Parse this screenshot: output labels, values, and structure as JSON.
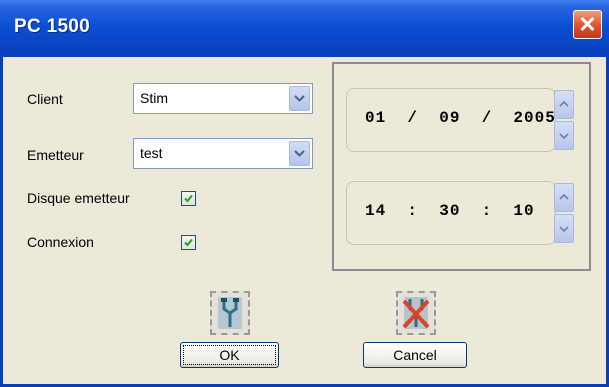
{
  "window": {
    "title": "PC 1500",
    "close_glyph": "✕"
  },
  "form": {
    "client_label": "Client",
    "client_value": "Stim",
    "emetteur_label": "Emetteur",
    "emetteur_value": "test",
    "disque_label": "Disque emetteur",
    "disque_checked": true,
    "connexion_label": "Connexion",
    "connexion_checked": true
  },
  "datetime": {
    "date": "01  /  09  /  2005",
    "time": "14  :  30  :  10"
  },
  "buttons": {
    "ok_label": "OK",
    "cancel_label": "Cancel"
  },
  "icons": {
    "ok_icon": "connect-plug-icon",
    "cancel_icon": "disconnect-plug-icon"
  },
  "colors": {
    "titlebar": "#0a4fd6",
    "close": "#e0502a",
    "accent": "#1c5180"
  }
}
